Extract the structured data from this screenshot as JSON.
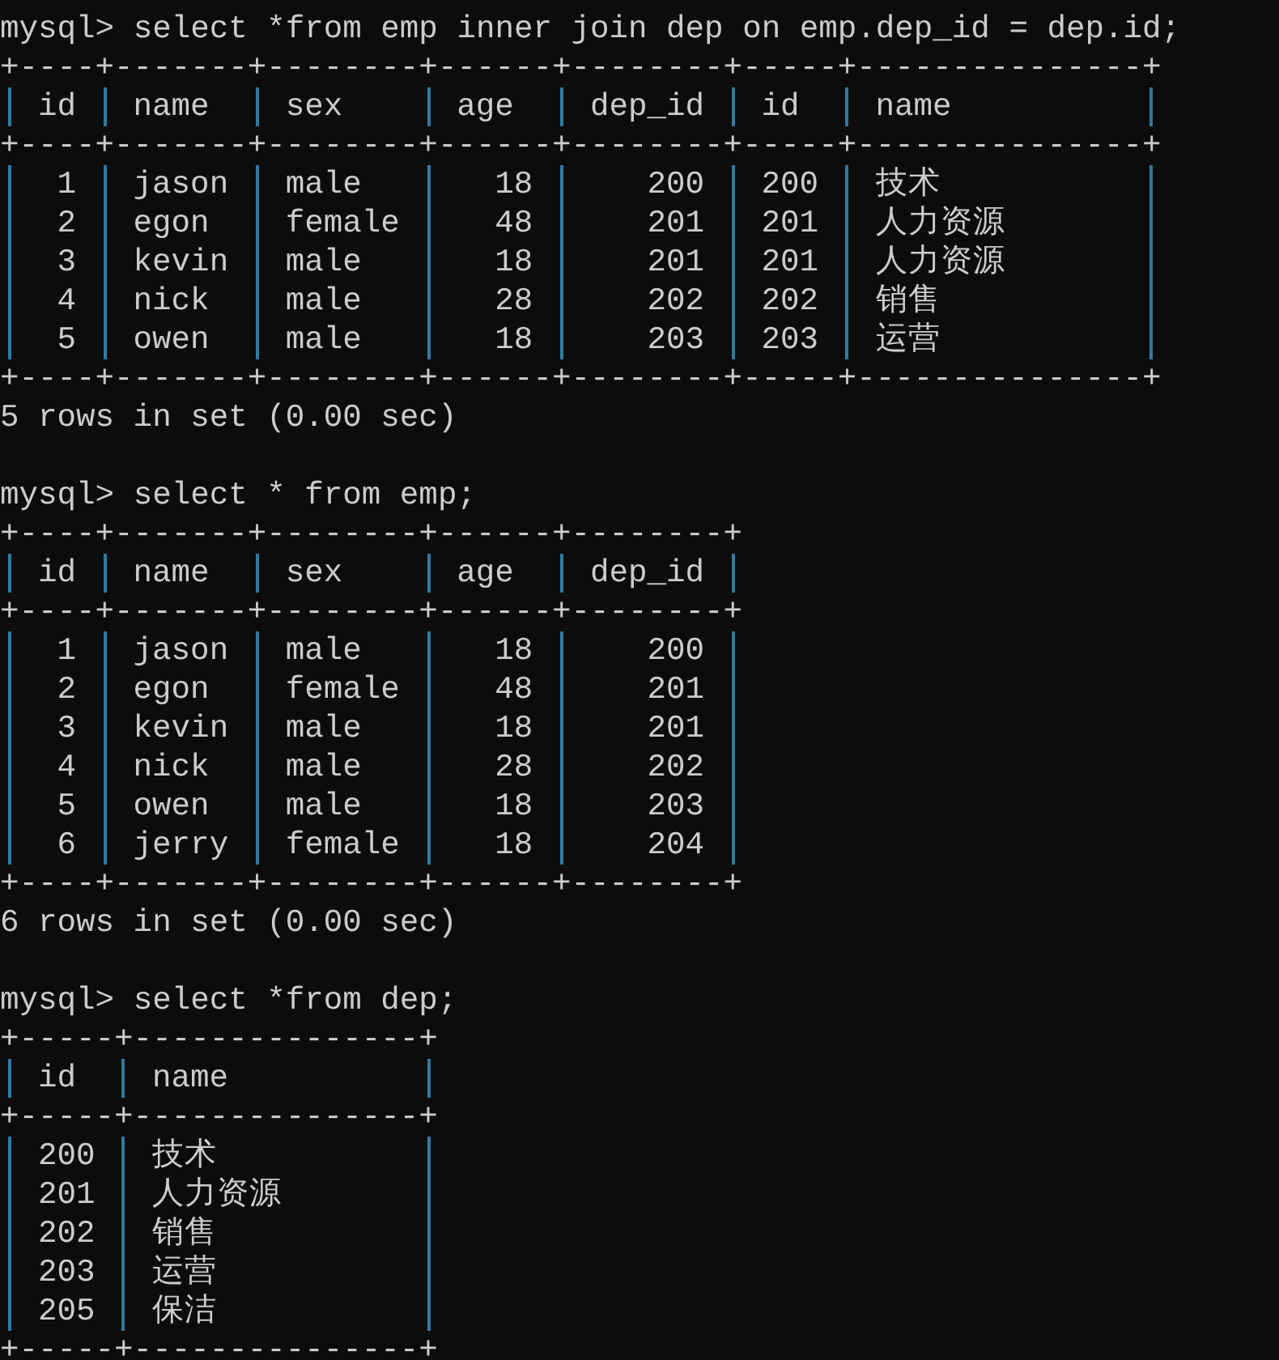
{
  "queries": [
    {
      "prompt": "mysql>",
      "command": "select *from emp inner join dep on emp.dep_id = dep.id;",
      "table": {
        "border_top": "+----+-------+--------+------+--------+-----+---------------+",
        "columns": [
          {
            "label": "id",
            "kind": "number"
          },
          {
            "label": "name",
            "kind": "text"
          },
          {
            "label": "sex",
            "kind": "text"
          },
          {
            "label": "age",
            "kind": "number"
          },
          {
            "label": "dep_id",
            "kind": "number"
          },
          {
            "label": "id",
            "kind": "number"
          },
          {
            "label": "name",
            "kind": "text"
          }
        ],
        "header_rule": "+----+-------+--------+------+--------+-----+---------------+",
        "rows": [
          [
            "1",
            "jason",
            "male",
            "18",
            "200",
            "200",
            "技术"
          ],
          [
            "2",
            "egon",
            "female",
            "48",
            "201",
            "201",
            "人力资源"
          ],
          [
            "3",
            "kevin",
            "male",
            "18",
            "201",
            "201",
            "人力资源"
          ],
          [
            "4",
            "nick",
            "male",
            "28",
            "202",
            "202",
            "销售"
          ],
          [
            "5",
            "owen",
            "male",
            "18",
            "203",
            "203",
            "运营"
          ]
        ],
        "border_bottom": "+----+-------+--------+------+--------+-----+---------------+"
      },
      "summary": "5 rows in set (0.00 sec)"
    },
    {
      "prompt": "mysql>",
      "command": "select * from emp;",
      "table": {
        "border_top": "+----+-------+--------+------+--------+",
        "columns": [
          {
            "label": "id",
            "kind": "number"
          },
          {
            "label": "name",
            "kind": "text"
          },
          {
            "label": "sex",
            "kind": "text"
          },
          {
            "label": "age",
            "kind": "number"
          },
          {
            "label": "dep_id",
            "kind": "number"
          }
        ],
        "header_rule": "+----+-------+--------+------+--------+",
        "rows": [
          [
            "1",
            "jason",
            "male",
            "18",
            "200"
          ],
          [
            "2",
            "egon",
            "female",
            "48",
            "201"
          ],
          [
            "3",
            "kevin",
            "male",
            "18",
            "201"
          ],
          [
            "4",
            "nick",
            "male",
            "28",
            "202"
          ],
          [
            "5",
            "owen",
            "male",
            "18",
            "203"
          ],
          [
            "6",
            "jerry",
            "female",
            "18",
            "204"
          ]
        ],
        "border_bottom": "+----+-------+--------+------+--------+"
      },
      "summary": "6 rows in set (0.00 sec)"
    },
    {
      "prompt": "mysql>",
      "command": "select *from dep;",
      "table": {
        "border_top": "+-----+---------------+",
        "columns": [
          {
            "label": "id",
            "kind": "number"
          },
          {
            "label": "name",
            "kind": "text"
          }
        ],
        "header_rule": "+-----+---------------+",
        "rows": [
          [
            "200",
            "技术"
          ],
          [
            "201",
            "人力资源"
          ],
          [
            "202",
            "销售"
          ],
          [
            "203",
            "运营"
          ],
          [
            "205",
            "保洁"
          ]
        ],
        "border_bottom": "+-----+---------------+"
      }
    }
  ]
}
